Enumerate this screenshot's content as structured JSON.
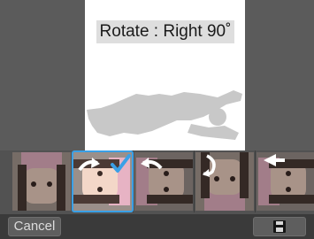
{
  "overlay": {
    "rotate_label": "Rotate : Right 90˚"
  },
  "thumbnails": [
    {
      "name": "original",
      "icon": "none",
      "selected": false
    },
    {
      "name": "rotate-right",
      "icon": "rotate-right-icon",
      "selected": true
    },
    {
      "name": "rotate-left",
      "icon": "rotate-left-icon",
      "selected": false
    },
    {
      "name": "rotate-180",
      "icon": "rotate-180-icon",
      "selected": false
    },
    {
      "name": "flip-horizontal",
      "icon": "flip-horizontal-icon",
      "selected": false
    }
  ],
  "bottom_bar": {
    "cancel_label": "Cancel",
    "save_icon": "save-icon"
  },
  "colors": {
    "selection": "#3aa0e6",
    "canvas": "#ffffff",
    "background": "#3a3a3a"
  }
}
